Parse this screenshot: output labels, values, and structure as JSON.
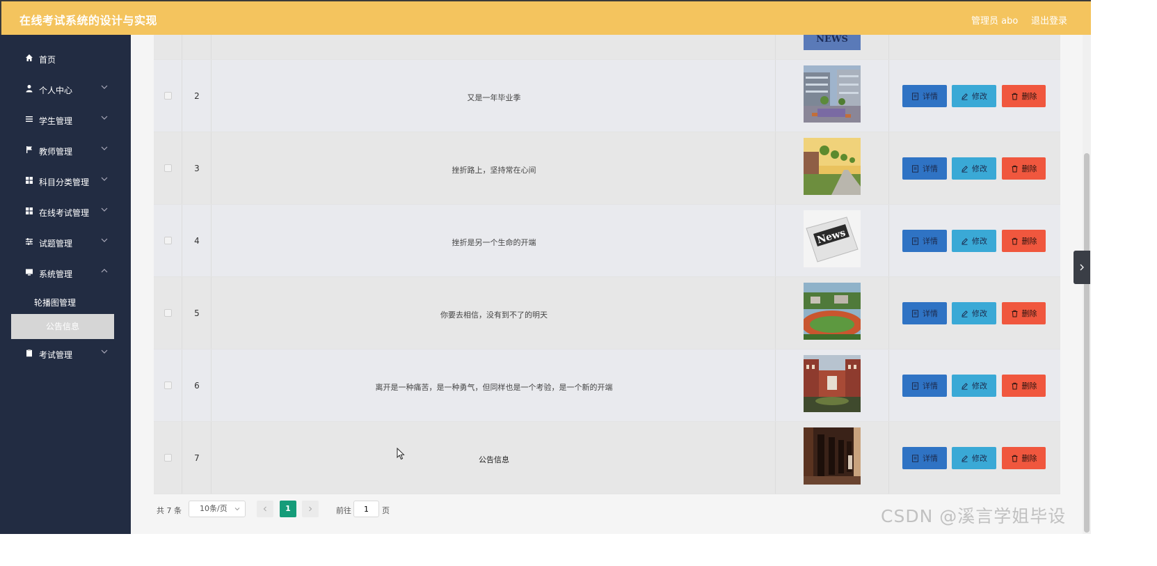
{
  "header": {
    "app_title": "在线考试系统的设计与实现",
    "admin_label": "管理员 abo",
    "logout_label": "退出登录",
    "bar_color": "#f4c45e"
  },
  "sidebar": {
    "items": [
      {
        "label": "首页",
        "icon": "home-icon"
      },
      {
        "label": "个人中心",
        "icon": "user-icon"
      },
      {
        "label": "学生管理",
        "icon": "list-icon"
      },
      {
        "label": "教师管理",
        "icon": "flag-icon"
      },
      {
        "label": "科目分类管理",
        "icon": "grid-icon"
      },
      {
        "label": "在线考试管理",
        "icon": "grid-icon"
      },
      {
        "label": "试题管理",
        "icon": "sliders-icon"
      },
      {
        "label": "系统管理",
        "icon": "monitor-icon"
      },
      {
        "label": "考试管理",
        "icon": "clipboard-icon"
      }
    ],
    "sub_items": [
      {
        "label": "轮播图管理"
      },
      {
        "label": "公告信息",
        "active": true
      }
    ]
  },
  "table": {
    "rows": [
      {
        "index": "",
        "title": "",
        "image": "news-banner"
      },
      {
        "index": "2",
        "title": "又是一年毕业季",
        "image": "campus-building-photo"
      },
      {
        "index": "3",
        "title": "挫折路上，坚持常在心间",
        "image": "campus-road-photo"
      },
      {
        "index": "4",
        "title": "挫折是另一个生命的开端",
        "image": "news-paper-photo"
      },
      {
        "index": "5",
        "title": "你要去相信，没有到不了的明天",
        "image": "sports-field-photo"
      },
      {
        "index": "6",
        "title": "离开是一种痛苦，是一种勇气，但同样也是一个考验，是一个新的开端",
        "image": "campus-hall-photo"
      },
      {
        "index": "7",
        "title": "公告信息",
        "image": "corridor-photo"
      }
    ],
    "actions": {
      "detail": "详情",
      "edit": "修改",
      "delete": "删除"
    }
  },
  "pagination": {
    "total": "共 7 条",
    "page_size": "10条/页",
    "current_page": "1",
    "goto_label": "前往",
    "goto_value": "1",
    "page_suffix": "页"
  },
  "watermark": "CSDN @溪言学姐毕设"
}
